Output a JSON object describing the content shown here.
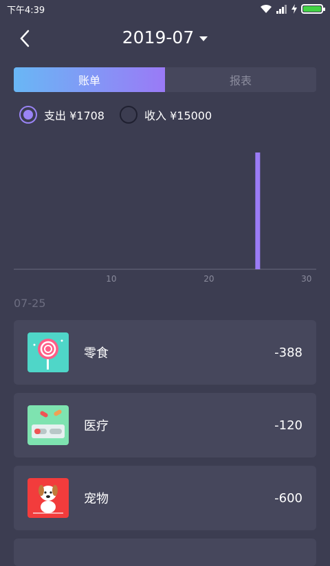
{
  "status_bar": {
    "time": "下午4:39"
  },
  "header": {
    "month": "2019-07"
  },
  "tabs": [
    {
      "label": "账单",
      "active": true
    },
    {
      "label": "报表",
      "active": false
    }
  ],
  "toggles": {
    "expense": {
      "label": "支出 ¥1708",
      "selected": true
    },
    "income": {
      "label": "收入 ¥15000",
      "selected": false
    }
  },
  "chart_data": {
    "type": "bar",
    "x": [
      25
    ],
    "values": [
      1708
    ],
    "xlim": [
      0,
      31
    ],
    "xticks": [
      "10",
      "20",
      "30"
    ],
    "color": "#9b7cf6"
  },
  "list": {
    "date": "07-25",
    "items": [
      {
        "name": "零食",
        "amount": "-388",
        "icon": "lollipop-icon"
      },
      {
        "name": "医疗",
        "amount": "-120",
        "icon": "pills-icon"
      },
      {
        "name": "宠物",
        "amount": "-600",
        "icon": "dog-icon"
      }
    ]
  },
  "colors": {
    "background": "#3c3d51",
    "card": "#46475c",
    "accent": "#9b7cf6",
    "tab_gradient_start": "#69b7f5",
    "tab_gradient_end": "#9a7af6"
  }
}
